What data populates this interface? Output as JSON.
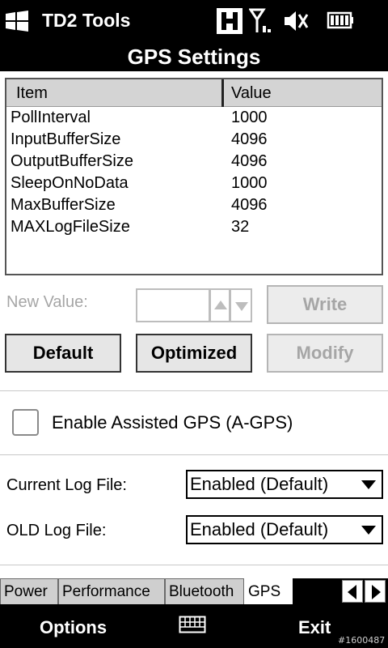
{
  "status_bar": {
    "app_title": "TD2 Tools",
    "icons": [
      "windows-start-icon",
      "h-data-icon",
      "signal-icon",
      "volume-muted-icon",
      "battery-icon"
    ]
  },
  "title_bar": {
    "title": "GPS Settings"
  },
  "settings_list": {
    "columns": [
      "Item",
      "Value"
    ],
    "rows": [
      {
        "name": "PollInterval",
        "value": "1000"
      },
      {
        "name": "InputBufferSize",
        "value": "4096"
      },
      {
        "name": "OutputBufferSize",
        "value": "4096"
      },
      {
        "name": "SleepOnNoData",
        "value": "1000"
      },
      {
        "name": "MaxBufferSize",
        "value": "4096"
      },
      {
        "name": "MAXLogFileSize",
        "value": "32"
      }
    ]
  },
  "edit": {
    "new_value_label": "New Value:",
    "new_value": "",
    "write_label": "Write",
    "write_enabled": false
  },
  "buttons": {
    "default_label": "Default",
    "optimized_label": "Optimized",
    "modify_label": "Modify",
    "modify_enabled": false
  },
  "agps": {
    "label": "Enable Assisted GPS (A-GPS)",
    "checked": false
  },
  "log_settings": {
    "current_label": "Current Log File:",
    "current_value": "Enabled (Default)",
    "old_label": "OLD Log File:",
    "old_value": "Enabled (Default)"
  },
  "tabs": {
    "items": [
      "Power",
      "Performance",
      "Bluetooth",
      "GPS"
    ],
    "active": "GPS"
  },
  "softkeys": {
    "left": "Options",
    "right": "Exit"
  },
  "watermark": "#1600487",
  "colors": {
    "bar_background": "#000000",
    "disabled_text": "#a6a6a6",
    "list_header": "#d4d4d4"
  }
}
